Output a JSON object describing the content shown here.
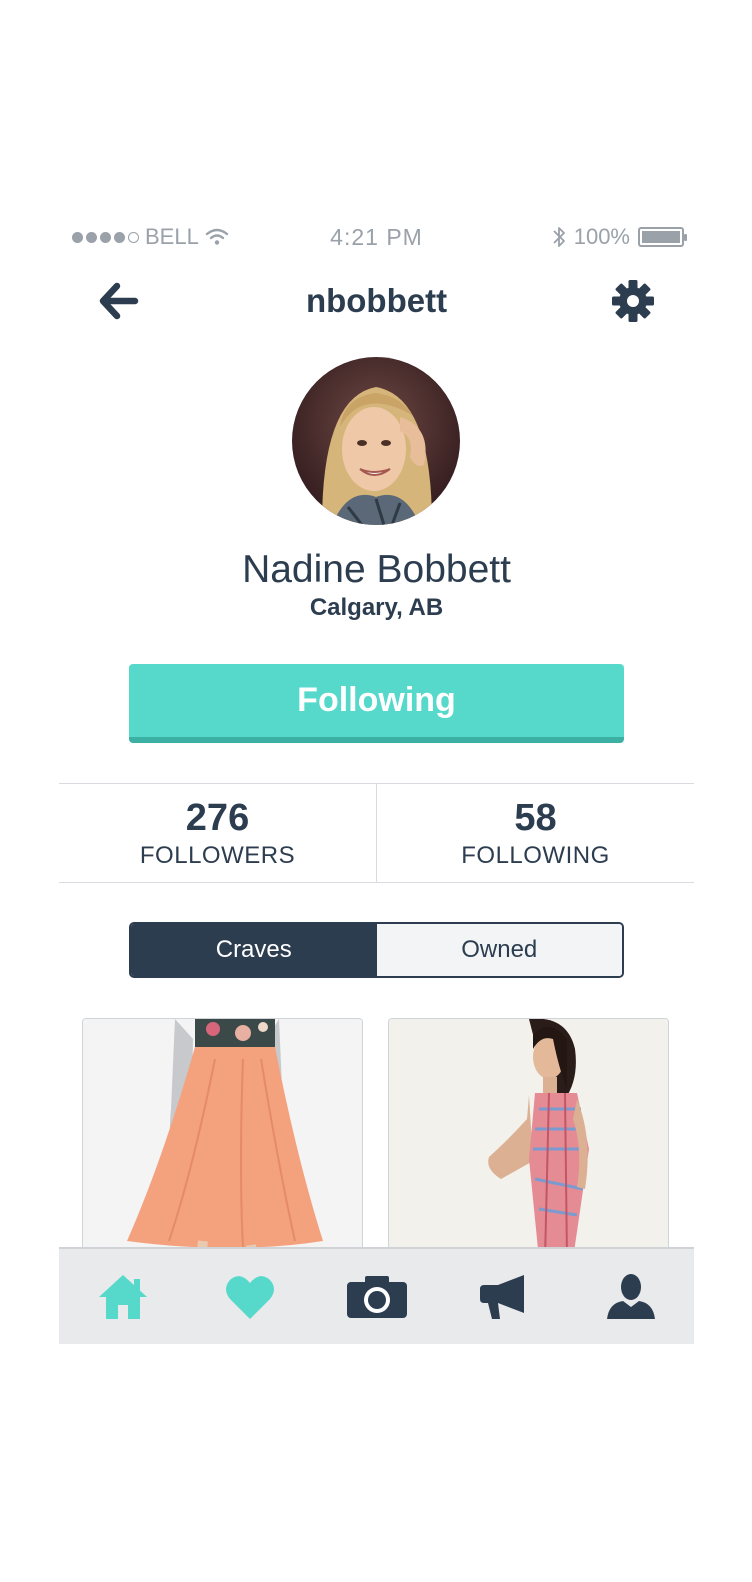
{
  "status_bar": {
    "carrier": "BELL",
    "time": "4:21 PM",
    "battery": "100%",
    "signal_bars_filled": 4,
    "signal_bars_total": 5
  },
  "nav": {
    "title": "nbobbett",
    "back_icon": "arrow-left-icon",
    "settings_icon": "gear-icon"
  },
  "profile": {
    "name": "Nadine Bobbett",
    "location": "Calgary, AB"
  },
  "follow_button": {
    "label": "Following"
  },
  "stats": {
    "followers": {
      "count": "276",
      "label": "FOLLOWERS"
    },
    "following": {
      "count": "58",
      "label": "FOLLOWING"
    }
  },
  "segment": {
    "options": [
      "Craves",
      "Owned"
    ],
    "selected": "Craves"
  },
  "items": [
    {
      "description_icon": "skirt-photo"
    },
    {
      "description_icon": "dress-photo"
    }
  ],
  "tabbar": {
    "tabs": [
      "home-icon",
      "heart-icon",
      "camera-icon",
      "megaphone-icon",
      "profile-icon"
    ],
    "active_color": "#56d9cb",
    "inactive_color": "#2d3d50"
  },
  "colors": {
    "accent": "#56d9cb",
    "dark": "#2d3d50",
    "muted": "#9aa1a9"
  }
}
